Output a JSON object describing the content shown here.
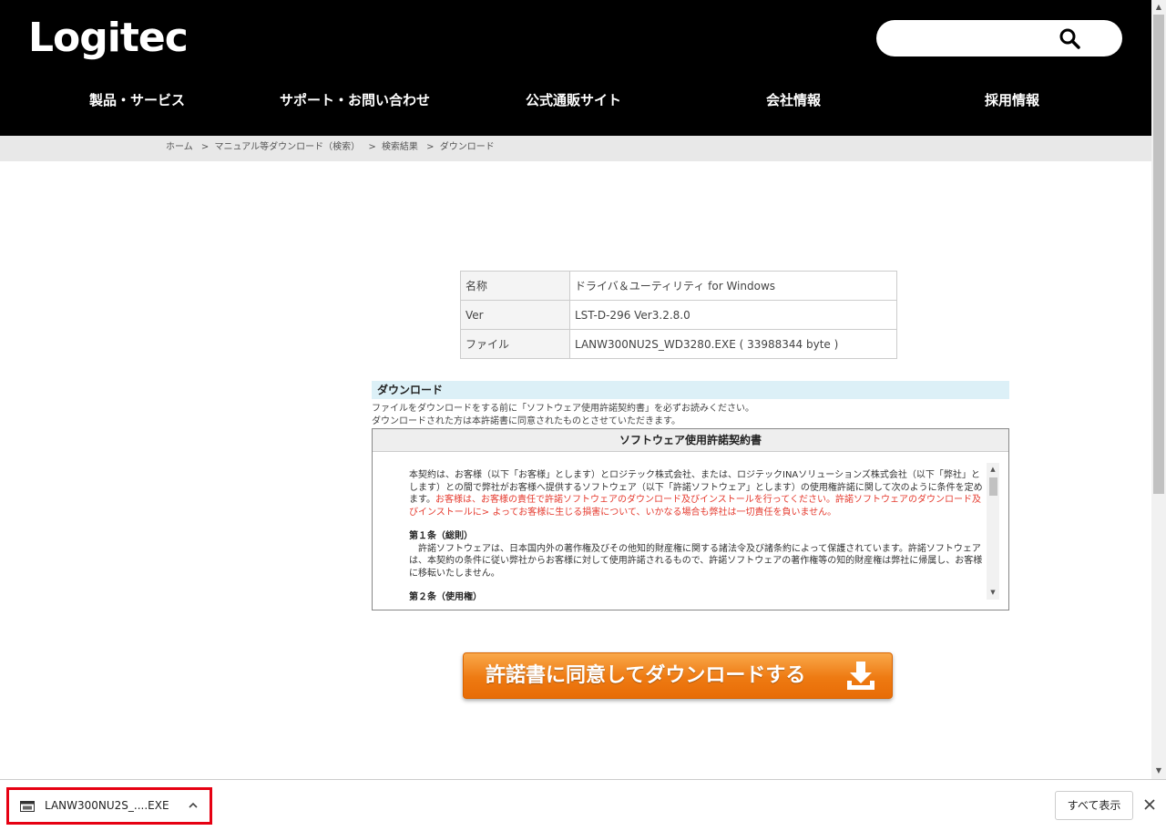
{
  "header": {
    "logo": "Logitec",
    "search": {
      "placeholder": ""
    },
    "nav": [
      "製品・サービス",
      "サポート・お問い合わせ",
      "公式通販サイト",
      "会社情報",
      "採用情報"
    ]
  },
  "breadcrumb": [
    {
      "label": "ホーム"
    },
    {
      "label": "マニュアル等ダウンロード（検索）"
    },
    {
      "label": "検索結果"
    },
    {
      "label": "ダウンロード"
    }
  ],
  "breadcrumb_separator": ">",
  "file_info": [
    {
      "key": "名称",
      "value": "ドライバ＆ユーティリティ for Windows"
    },
    {
      "key": "Ver",
      "value": "LST-D-296 Ver3.2.8.0"
    },
    {
      "key": "ファイル",
      "value": "LANW300NU2S_WD3280.EXE ( 33988344 byte )"
    }
  ],
  "download": {
    "heading": "ダウンロード",
    "note_line1": "ファイルをダウンロードをする前に「ソフトウェア使用許諾契約書」を必ずお読みください。",
    "note_line2": "ダウンロードされた方は本許諾書に同意されたものとさせていただきます。",
    "license_title": "ソフトウェア使用許諾契約書",
    "license_intro_a": "本契約は、お客様（以下「お客様」とします）とロジテック株式会社、または、ロジテックINAソリューションズ株式会社（以下「弊社」とします）との間で弊社がお客様へ提供するソフトウェア（以下「許諾ソフトウェア」とします）の使用権許諾に関して次のように条件を定めます。",
    "license_intro_b": "お客様は、お客様の責任で許諾ソフトウェアのダウンロード及びインストールを行ってください。許諾ソフトウェアのダウンロード及びインストールに> よってお客様に生じる損害について、いかなる場合も弊社は一切責任を負いません。",
    "article1_title": "第１条（総則）",
    "article1_body": "　許諾ソフトウェアは、日本国内外の著作権及びその他知的財産権に関する諸法令及び諸条約によって保護されています。許諾ソフトウェアは、本契約の条件に従い弊社からお客様に対して使用許諾されるもので、許諾ソフトウェアの著作権等の知的財産権は弊社に帰属し、お客様に移転いたしません。",
    "article2_title": "第２条（使用権）",
    "agree_button": "許諾書に同意してダウンロードする"
  },
  "download_shelf": {
    "file_name": "LANW300NU2S_....EXE",
    "show_all": "すべて表示"
  },
  "colors": {
    "header_bg": "#000000",
    "accent_orange": "#ee7a12",
    "section_head_bg": "#dcf0f7",
    "license_red": "#e53a2e",
    "highlight_red": "#e60012"
  }
}
